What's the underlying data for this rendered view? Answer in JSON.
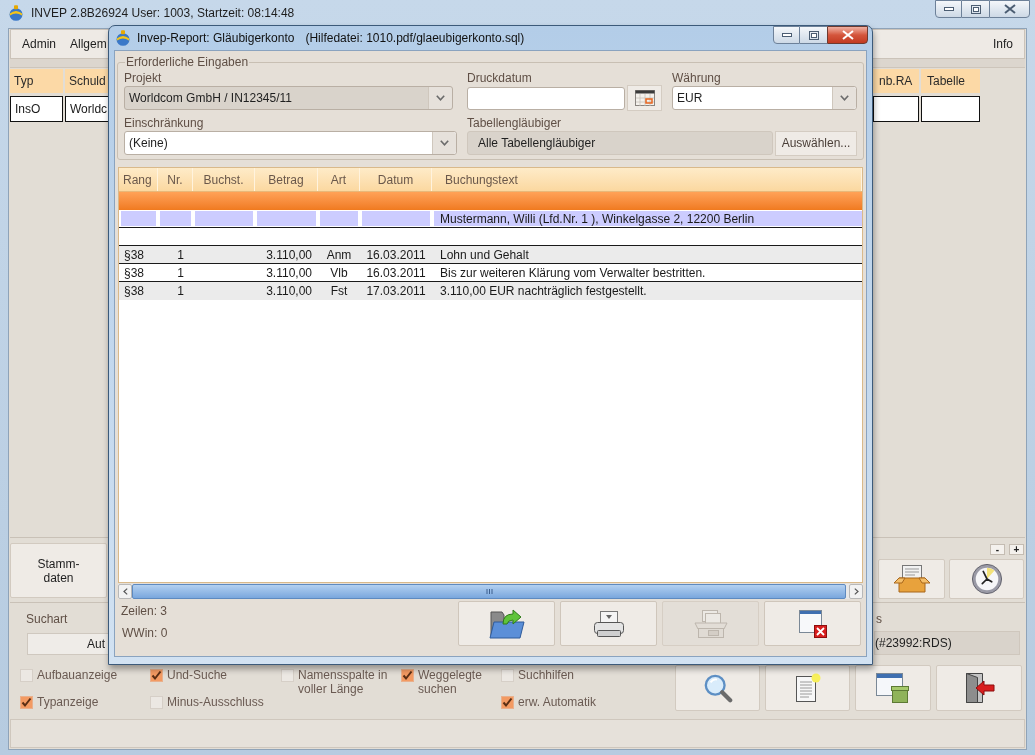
{
  "main_window": {
    "title": "INVEP 2.8B26924 User: 1003, Startzeit: 08:14:48",
    "active": false,
    "menu": [
      {
        "label": "Admin"
      },
      {
        "label": "Allgem"
      }
    ],
    "menu_right": [
      {
        "label": "Info"
      }
    ],
    "table": {
      "columns_left": [
        "Typ",
        "Schuld"
      ],
      "columns_right": [
        "nb.RA",
        "Tabelle"
      ],
      "row_left": [
        "InsO",
        "Worldc"
      ]
    },
    "master_data_button": {
      "lines": [
        "Stamm-",
        "daten"
      ]
    },
    "size_buttons": [
      "-",
      "+"
    ],
    "search_mode": {
      "label": "Suchart",
      "value": "Aut"
    },
    "status_field": {
      "label": "s",
      "value": "(#23992:RDS)"
    },
    "options": [
      {
        "items": [
          {
            "label": "Aufbauanzeige",
            "checked": false
          },
          {
            "label": "Typanzeige",
            "checked": true
          }
        ]
      },
      {
        "items": [
          {
            "label": "Und-Suche",
            "checked": true
          },
          {
            "label": "Minus-Ausschluss",
            "checked": false
          }
        ]
      },
      {
        "items": [
          {
            "label": "Namensspalte in voller Länge",
            "checked": false
          }
        ]
      },
      {
        "items": [
          {
            "label": "Weggelegte suchen",
            "checked": true
          }
        ]
      },
      {
        "items": [
          {
            "label": "Suchhilfen",
            "checked": false
          },
          {
            "label": "erw. Automatik",
            "checked": true
          }
        ]
      }
    ]
  },
  "dialog": {
    "title": "Invep-Report: Gläubigerkonto",
    "help_file": "(Hilfedatei: 1010.pdf/glaeubigerkonto.sql)",
    "active": true,
    "group_title": "Erforderliche Eingaben",
    "project": {
      "label": "Projekt",
      "value": "Worldcom GmbH / IN12345/11",
      "disabled": true
    },
    "print_date": {
      "label": "Druckdatum"
    },
    "currency": {
      "label": "Währung",
      "value": "EUR",
      "disabled": false
    },
    "restriction": {
      "label": "Einschränkung",
      "value": "(Keine)",
      "disabled": false
    },
    "table_creditors": {
      "label": "Tabellengläubiger",
      "value": "Alle Tabellengläubiger",
      "button": "Auswählen..."
    },
    "table": {
      "columns": [
        {
          "label": "Rang"
        },
        {
          "label": "Nr."
        },
        {
          "label": "Buchst."
        },
        {
          "label": "Betrag"
        },
        {
          "label": "Art"
        },
        {
          "label": "Datum"
        },
        {
          "label": "Buchungstext"
        }
      ],
      "rows": [
        {
          "kind": "group"
        },
        {
          "kind": "creditor",
          "text": "Mustermann, Willi (Lfd.Nr. 1 ), Winkelgasse 2, 12200 Berlin"
        },
        {
          "kind": "blank"
        },
        {
          "kind": "entry",
          "rank": "§38",
          "number": "1",
          "amount": "3.110,00",
          "type": "Anm",
          "date": "16.03.2011",
          "text": "Lohn und Gehalt"
        },
        {
          "kind": "entry",
          "rank": "§38",
          "number": "1",
          "amount": "3.110,00",
          "type": "Vlb",
          "date": "16.03.2011",
          "text": "Bis zur weiteren Klärung vom Verwalter bestritten."
        },
        {
          "kind": "entry",
          "rank": "§38",
          "number": "1",
          "amount": "3.110,00",
          "type": "Fst",
          "date": "17.03.2011",
          "text": "3.110,00 EUR nachträglich festgestellt."
        }
      ]
    },
    "row_count": "Zeilen: 3",
    "wwin": "WWin: 0",
    "footer_buttons": [
      {
        "kind": "export",
        "disabled": false
      },
      {
        "kind": "print",
        "disabled": false
      },
      {
        "kind": "preview",
        "disabled": true
      },
      {
        "kind": "close",
        "disabled": false
      }
    ]
  }
}
